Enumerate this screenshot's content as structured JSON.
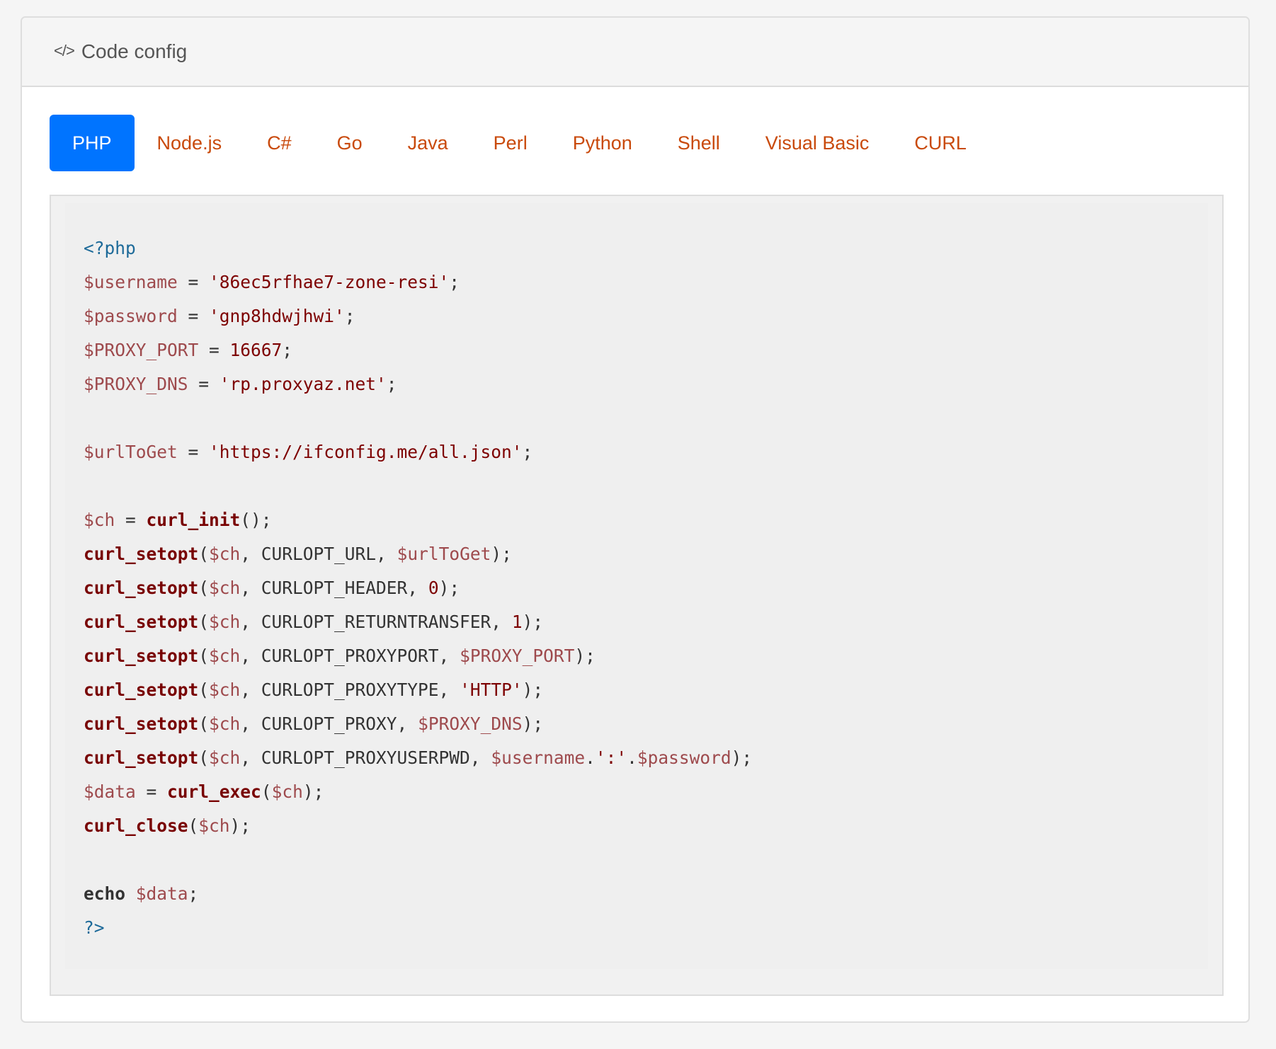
{
  "header": {
    "icon": "code-icon",
    "icon_glyph": "</>",
    "title": "Code config"
  },
  "tabs": [
    {
      "label": "PHP",
      "active": true
    },
    {
      "label": "Node.js",
      "active": false
    },
    {
      "label": "C#",
      "active": false
    },
    {
      "label": "Go",
      "active": false
    },
    {
      "label": "Java",
      "active": false
    },
    {
      "label": "Perl",
      "active": false
    },
    {
      "label": "Python",
      "active": false
    },
    {
      "label": "Shell",
      "active": false
    },
    {
      "label": "Visual Basic",
      "active": false
    },
    {
      "label": "CURL",
      "active": false
    }
  ],
  "colors": {
    "active_tab_bg": "#0074ff",
    "tab_text": "#c94a0c",
    "php_tag": "#1d6a99",
    "variable": "#9e4a4d",
    "string": "#7d0000",
    "function": "#780000"
  },
  "code": {
    "language": "PHP",
    "lines": [
      [
        {
          "t": "tag",
          "v": "<?php"
        }
      ],
      [
        {
          "t": "var",
          "v": "$username"
        },
        {
          "t": "plain",
          "v": " = "
        },
        {
          "t": "str",
          "v": "'86ec5rfhae7-zone-resi'"
        },
        {
          "t": "plain",
          "v": ";"
        }
      ],
      [
        {
          "t": "var",
          "v": "$password"
        },
        {
          "t": "plain",
          "v": " = "
        },
        {
          "t": "str",
          "v": "'gnp8hdwjhwi'"
        },
        {
          "t": "plain",
          "v": ";"
        }
      ],
      [
        {
          "t": "var",
          "v": "$PROXY_PORT"
        },
        {
          "t": "plain",
          "v": " = "
        },
        {
          "t": "num",
          "v": "16667"
        },
        {
          "t": "plain",
          "v": ";"
        }
      ],
      [
        {
          "t": "var",
          "v": "$PROXY_DNS"
        },
        {
          "t": "plain",
          "v": " = "
        },
        {
          "t": "str",
          "v": "'rp.proxyaz.net'"
        },
        {
          "t": "plain",
          "v": ";"
        }
      ],
      [],
      [
        {
          "t": "var",
          "v": "$urlToGet"
        },
        {
          "t": "plain",
          "v": " = "
        },
        {
          "t": "str",
          "v": "'https://ifconfig.me/all.json'"
        },
        {
          "t": "plain",
          "v": ";"
        }
      ],
      [],
      [
        {
          "t": "var",
          "v": "$ch"
        },
        {
          "t": "plain",
          "v": " = "
        },
        {
          "t": "fn",
          "v": "curl_init"
        },
        {
          "t": "plain",
          "v": "();"
        }
      ],
      [
        {
          "t": "fn",
          "v": "curl_setopt"
        },
        {
          "t": "plain",
          "v": "("
        },
        {
          "t": "var",
          "v": "$ch"
        },
        {
          "t": "plain",
          "v": ", CURLOPT_URL, "
        },
        {
          "t": "var",
          "v": "$urlToGet"
        },
        {
          "t": "plain",
          "v": ");"
        }
      ],
      [
        {
          "t": "fn",
          "v": "curl_setopt"
        },
        {
          "t": "plain",
          "v": "("
        },
        {
          "t": "var",
          "v": "$ch"
        },
        {
          "t": "plain",
          "v": ", CURLOPT_HEADER, "
        },
        {
          "t": "num",
          "v": "0"
        },
        {
          "t": "plain",
          "v": ");"
        }
      ],
      [
        {
          "t": "fn",
          "v": "curl_setopt"
        },
        {
          "t": "plain",
          "v": "("
        },
        {
          "t": "var",
          "v": "$ch"
        },
        {
          "t": "plain",
          "v": ", CURLOPT_RETURNTRANSFER, "
        },
        {
          "t": "num",
          "v": "1"
        },
        {
          "t": "plain",
          "v": ");"
        }
      ],
      [
        {
          "t": "fn",
          "v": "curl_setopt"
        },
        {
          "t": "plain",
          "v": "("
        },
        {
          "t": "var",
          "v": "$ch"
        },
        {
          "t": "plain",
          "v": ", CURLOPT_PROXYPORT, "
        },
        {
          "t": "var",
          "v": "$PROXY_PORT"
        },
        {
          "t": "plain",
          "v": ");"
        }
      ],
      [
        {
          "t": "fn",
          "v": "curl_setopt"
        },
        {
          "t": "plain",
          "v": "("
        },
        {
          "t": "var",
          "v": "$ch"
        },
        {
          "t": "plain",
          "v": ", CURLOPT_PROXYTYPE, "
        },
        {
          "t": "str",
          "v": "'HTTP'"
        },
        {
          "t": "plain",
          "v": ");"
        }
      ],
      [
        {
          "t": "fn",
          "v": "curl_setopt"
        },
        {
          "t": "plain",
          "v": "("
        },
        {
          "t": "var",
          "v": "$ch"
        },
        {
          "t": "plain",
          "v": ", CURLOPT_PROXY, "
        },
        {
          "t": "var",
          "v": "$PROXY_DNS"
        },
        {
          "t": "plain",
          "v": ");"
        }
      ],
      [
        {
          "t": "fn",
          "v": "curl_setopt"
        },
        {
          "t": "plain",
          "v": "("
        },
        {
          "t": "var",
          "v": "$ch"
        },
        {
          "t": "plain",
          "v": ", CURLOPT_PROXYUSERPWD, "
        },
        {
          "t": "var",
          "v": "$username"
        },
        {
          "t": "plain",
          "v": "."
        },
        {
          "t": "str",
          "v": "':'"
        },
        {
          "t": "plain",
          "v": "."
        },
        {
          "t": "var",
          "v": "$password"
        },
        {
          "t": "plain",
          "v": ");"
        }
      ],
      [
        {
          "t": "var",
          "v": "$data"
        },
        {
          "t": "plain",
          "v": " = "
        },
        {
          "t": "fn",
          "v": "curl_exec"
        },
        {
          "t": "plain",
          "v": "("
        },
        {
          "t": "var",
          "v": "$ch"
        },
        {
          "t": "plain",
          "v": ");"
        }
      ],
      [
        {
          "t": "fn",
          "v": "curl_close"
        },
        {
          "t": "plain",
          "v": "("
        },
        {
          "t": "var",
          "v": "$ch"
        },
        {
          "t": "plain",
          "v": ");"
        }
      ],
      [],
      [
        {
          "t": "kw",
          "v": "echo"
        },
        {
          "t": "plain",
          "v": " "
        },
        {
          "t": "var",
          "v": "$data"
        },
        {
          "t": "plain",
          "v": ";"
        }
      ],
      [
        {
          "t": "tag",
          "v": "?>"
        }
      ]
    ]
  }
}
